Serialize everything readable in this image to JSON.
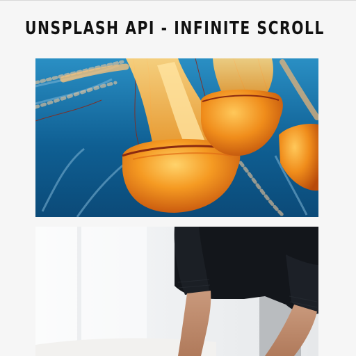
{
  "header": {
    "title": "UNSPLASH API - INFINITE SCROLL"
  },
  "gallery": {
    "photos": [
      {
        "subject": "orange jellyfish underwater",
        "colors": [
          "#0f5f8f",
          "#f39a1e"
        ]
      },
      {
        "subject": "person in black sweater working at a white table",
        "colors": [
          "#f5f6f7",
          "#15181d"
        ]
      }
    ]
  }
}
